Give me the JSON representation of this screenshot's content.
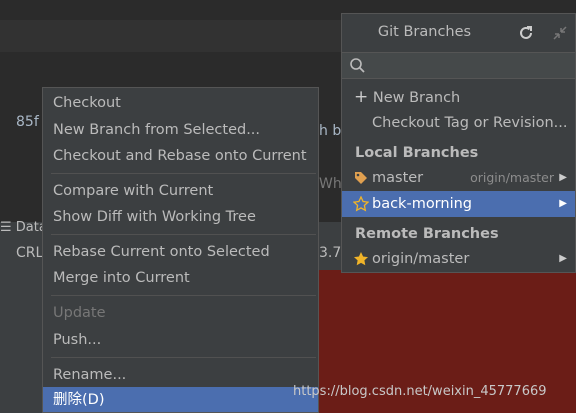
{
  "background": {
    "commit_hash": "85f",
    "partial_text_1": "h b",
    "partial_text_2": "Wh",
    "status_data": "Data",
    "status_crlf": "CRL",
    "status_num": "3.7"
  },
  "context_menu": {
    "items": [
      {
        "label": "Checkout"
      },
      {
        "label": "New Branch from Selected..."
      },
      {
        "label": "Checkout and Rebase onto Current"
      },
      {
        "label": "Compare with Current"
      },
      {
        "label": "Show Diff with Working Tree"
      },
      {
        "label": "Rebase Current onto Selected"
      },
      {
        "label": "Merge into Current"
      },
      {
        "label": "Update"
      },
      {
        "label": "Push..."
      },
      {
        "label": "Rename..."
      },
      {
        "label": "删除(D)"
      }
    ]
  },
  "branches_popup": {
    "title": "Git Branches",
    "new_branch": "New Branch",
    "checkout_tag": "Checkout Tag or Revision...",
    "local_header": "Local Branches",
    "local": [
      {
        "name": "master",
        "tracking": "origin/master"
      },
      {
        "name": "back-morning",
        "tracking": ""
      }
    ],
    "remote_header": "Remote Branches",
    "remote": [
      {
        "name": "origin/master"
      }
    ]
  },
  "watermark": "https://blog.csdn.net/weixin_45777669",
  "colors": {
    "accent": "#4b6eaf",
    "tag": "#e0a050",
    "star": "#f0b429"
  }
}
